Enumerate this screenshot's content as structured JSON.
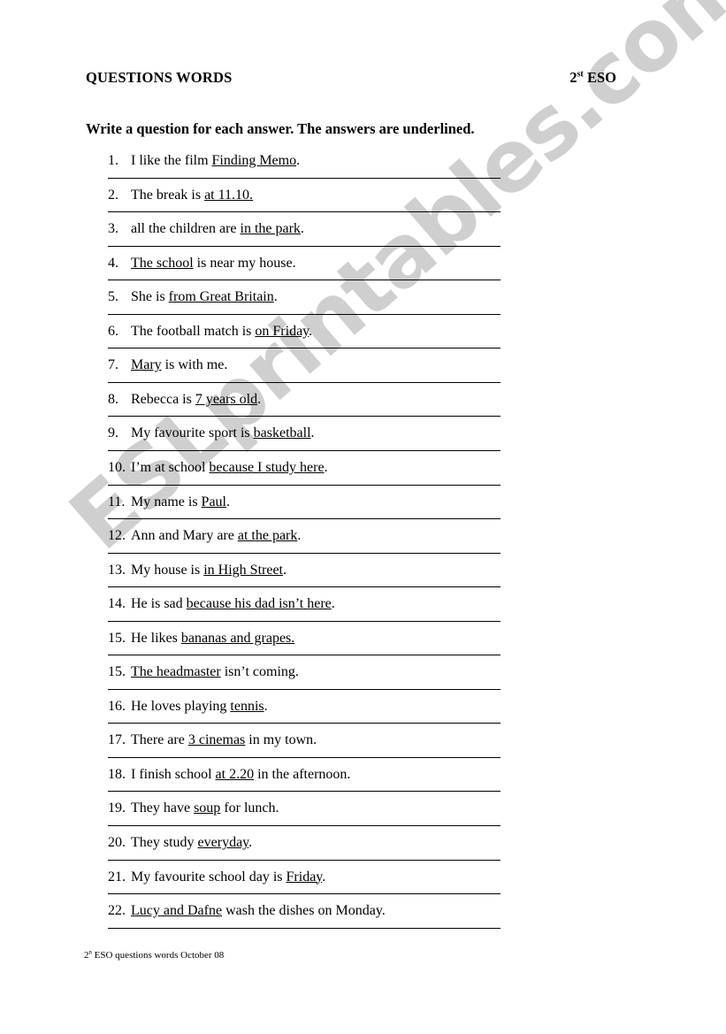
{
  "document": {
    "header": {
      "title": "QUESTIONS WORDS",
      "level_number": "2",
      "level_suffix": "st",
      "level_rest": " ESO"
    },
    "instruction": "Write a question for each answer. The answers are underlined.",
    "footer": {
      "prefix": "2",
      "suffix": "n",
      "rest": " ESO questions words October 08"
    },
    "watermark": "ESLprintables.com",
    "watermark_color": "#cfcfcf",
    "rule_color": "#000000",
    "questions": [
      {
        "number": "1.",
        "before": "I like the film ",
        "answer": "Finding Memo",
        "after": "."
      },
      {
        "number": "2.",
        "before": "The break is ",
        "answer": "at 11.10.",
        "after": ""
      },
      {
        "number": "3.",
        "before": "all the children are ",
        "answer": "in the park",
        "after": "."
      },
      {
        "number": "4.",
        "before": "",
        "answer": "The school",
        "after": " is near my house."
      },
      {
        "number": "5.",
        "before": "She is ",
        "answer": "from Great Britain",
        "after": "."
      },
      {
        "number": "6.",
        "before": "The football match is ",
        "answer": "on Friday",
        "after": "."
      },
      {
        "number": "7.",
        "before": "",
        "answer": "Mary",
        "after": " is with me."
      },
      {
        "number": "8.",
        "before": "Rebecca is ",
        "answer": "7 years old",
        "after": "."
      },
      {
        "number": "9.",
        "before": "My favourite sport is ",
        "answer": "basketball",
        "after": "."
      },
      {
        "number": "10.",
        "before": "I’m at school ",
        "answer": "because I study here",
        "after": "."
      },
      {
        "number": "11.",
        "before": "My name is ",
        "answer": "Paul",
        "after": "."
      },
      {
        "number": "12.",
        "before": "Ann and Mary are ",
        "answer": "at the park",
        "after": "."
      },
      {
        "number": "13.",
        "before": "My house is ",
        "answer": "in High Street",
        "after": "."
      },
      {
        "number": "14.",
        "before": "He is sad ",
        "answer": "because his dad isn’t here",
        "after": "."
      },
      {
        "number": "15.",
        "before": "He likes ",
        "answer": "bananas and grapes.",
        "after": ""
      },
      {
        "number": "15.",
        "before": "",
        "answer": "The headmaster",
        "after": " isn’t coming."
      },
      {
        "number": "16.",
        "before": "He loves playing ",
        "answer": "tennis",
        "after": "."
      },
      {
        "number": "17.",
        "before": "There are ",
        "answer": "3 cinemas",
        "after": " in my town."
      },
      {
        "number": "18.",
        "before": "I finish school ",
        "answer": "at 2.20",
        "after": " in the afternoon."
      },
      {
        "number": "19.",
        "before": "They have ",
        "answer": "soup",
        "after": " for lunch."
      },
      {
        "number": "20.",
        "before": "They study ",
        "answer": "everyday",
        "after": "."
      },
      {
        "number": "21.",
        "before": "My favourite school day is ",
        "answer": "Friday",
        "after": "."
      },
      {
        "number": "22.",
        "before": "",
        "answer": "Lucy and Dafne",
        "after": " wash the dishes on Monday."
      }
    ]
  }
}
